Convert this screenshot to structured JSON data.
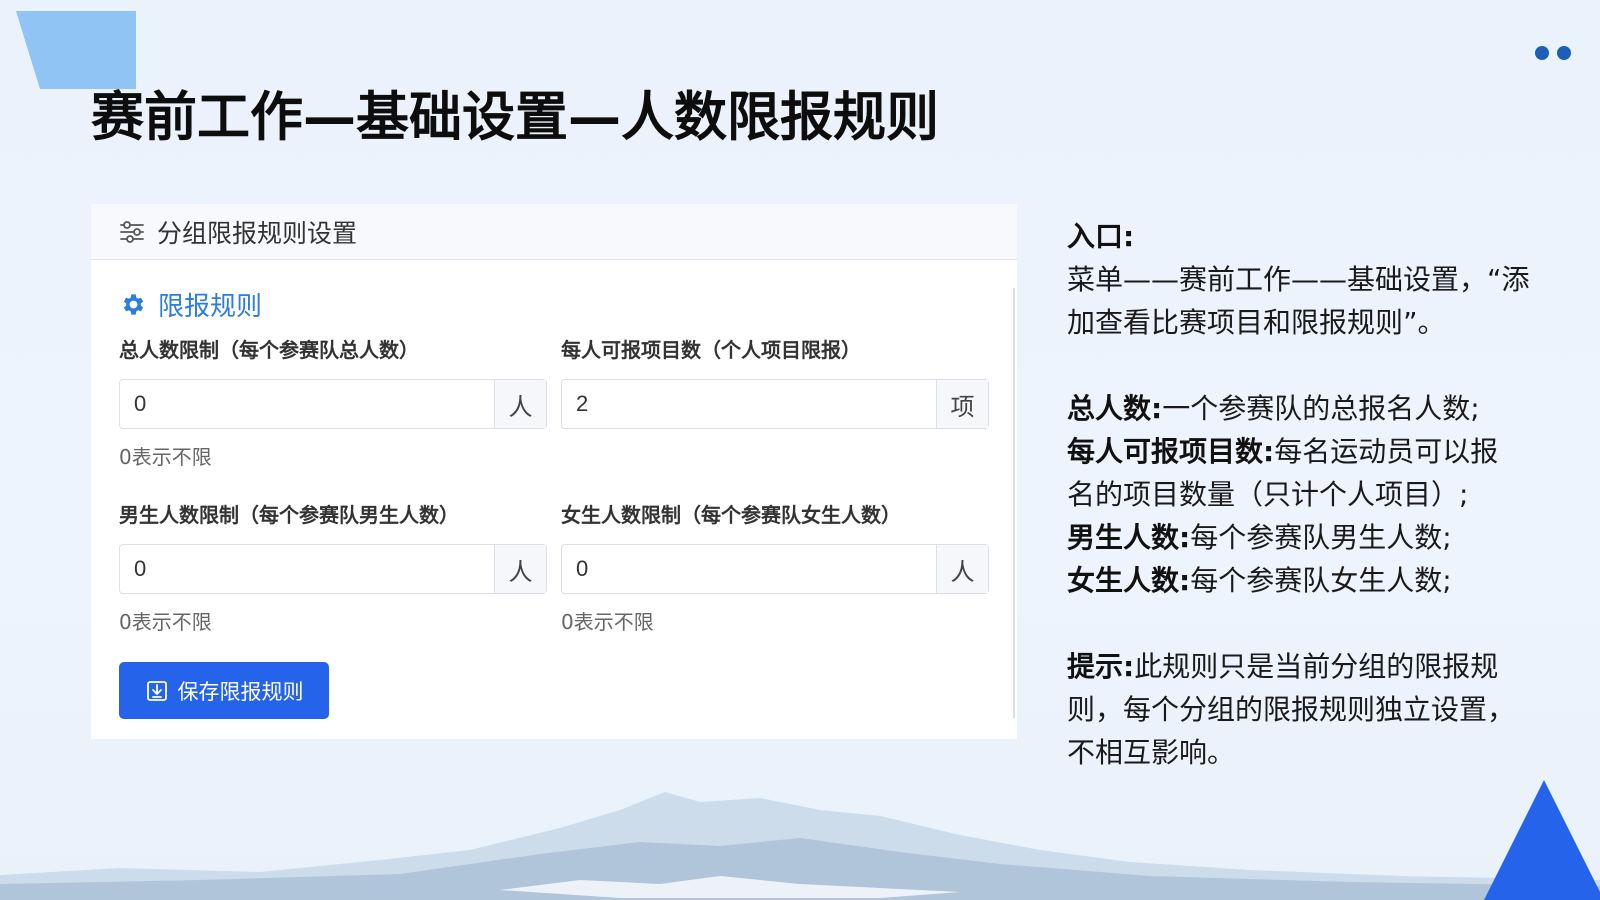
{
  "page": {
    "title": "赛前工作—基础设置—人数限报规则"
  },
  "panel": {
    "header_title": "分组限报规则设置",
    "section_title": "限报规则",
    "fields": [
      {
        "label": "总人数限制（每个参赛队总人数）",
        "value": "0",
        "addon": "人",
        "hint": "0表示不限"
      },
      {
        "label": "每人可报项目数（个人项目限报）",
        "value": "2",
        "addon": "项",
        "hint": ""
      },
      {
        "label": "男生人数限制（每个参赛队男生人数）",
        "value": "0",
        "addon": "人",
        "hint": "0表示不限"
      },
      {
        "label": "女生人数限制（每个参赛队女生人数）",
        "value": "0",
        "addon": "人",
        "hint": "0表示不限"
      }
    ],
    "save_button_label": "保存限报规则"
  },
  "notes": {
    "entry_title": "入口:",
    "entry_text_1": "菜单——赛前工作——基础设置，“添",
    "entry_text_2": "加查看比赛项目和限报规则”。",
    "total_label": "总人数:",
    "total_text": "一个参赛队的总报名人数;",
    "per_person_label": "每人可报项目数:",
    "per_person_text_1": "每名运动员可以报",
    "per_person_text_2": "名的项目数量（只计个人项目）;",
    "male_label": "男生人数:",
    "male_text": "每个参赛队男生人数;",
    "female_label": "女生人数:",
    "female_text": "每个参赛队女生人数;",
    "tip_label": "提示:",
    "tip_text_1": "此规则只是当前分组的限报规",
    "tip_text_2": "则，每个分组的限报规则独立设置，",
    "tip_text_3": "不相互影响。"
  },
  "colors": {
    "accent": "#2563eb",
    "section_title": "#2b7de0",
    "decor_light": "#8fc4f4",
    "decor_dots": "#1d5fb8"
  },
  "icons": {
    "header": "sliders-icon",
    "section": "gear-icon",
    "save": "save-icon"
  }
}
